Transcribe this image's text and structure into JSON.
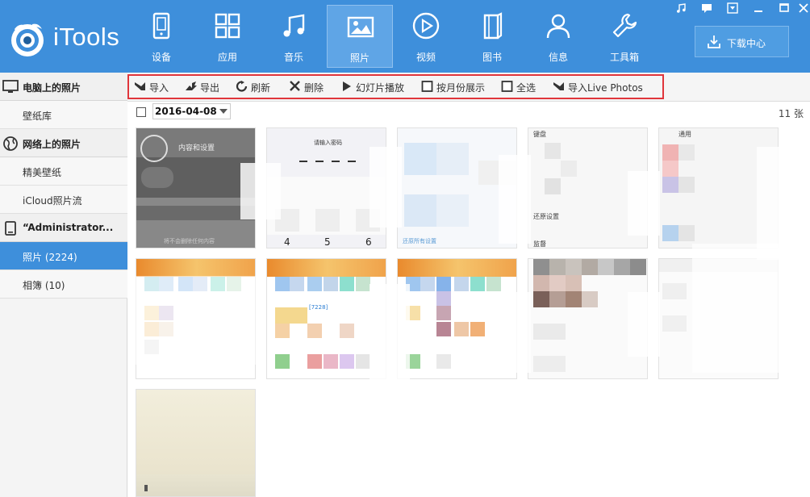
{
  "app": {
    "logo_text": "iTools"
  },
  "nav": {
    "items": [
      {
        "label": "设备",
        "icon": "device-icon"
      },
      {
        "label": "应用",
        "icon": "apps-icon"
      },
      {
        "label": "音乐",
        "icon": "music-icon"
      },
      {
        "label": "照片",
        "icon": "photo-icon",
        "active": true
      },
      {
        "label": "视频",
        "icon": "video-icon"
      },
      {
        "label": "图书",
        "icon": "book-icon"
      },
      {
        "label": "信息",
        "icon": "user-icon"
      },
      {
        "label": "工具箱",
        "icon": "wrench-icon"
      }
    ],
    "download_label": "下载中心"
  },
  "window_controls": [
    "music-icon",
    "message-icon",
    "menu-icon",
    "minimize-icon",
    "maximize-icon",
    "close-icon"
  ],
  "sidebar": {
    "pc_photos": "电脑上的照片",
    "wallpaper_lib": "壁纸库",
    "web_photos": "网络上的照片",
    "fine_wallpaper": "精美壁纸",
    "icloud_stream": "iCloud照片流",
    "device_name": "“Administrator...",
    "photos": "照片 (2224)",
    "albums": "相簿 (10)"
  },
  "toolbar": {
    "import": "导入",
    "export": "导出",
    "refresh": "刷新",
    "delete": "删除",
    "slideshow": "幻灯片播放",
    "by_month": "按月份展示",
    "select_all": "全选",
    "import_live": "导入Live Photos"
  },
  "datebar": {
    "date": "2016-04-08",
    "count": "11 张"
  },
  "thumb_texts": {
    "t1_title": "内容和设置",
    "t1_bottom": "将不会删除任何内容",
    "t2_title": "请输入密码",
    "t2_nums": [
      "4",
      "5",
      "6"
    ],
    "t3_bottom": "还原所有设置",
    "t4_top": "键盘",
    "t4_mid": "还原设置",
    "t4_bottom": "监督",
    "t5_top": "通用",
    "t7_mid": "[7228]"
  },
  "colors": {
    "header_blue": "#3e8fdb",
    "active_blue": "#5fa5e6",
    "highlight_red": "#e0353b"
  }
}
